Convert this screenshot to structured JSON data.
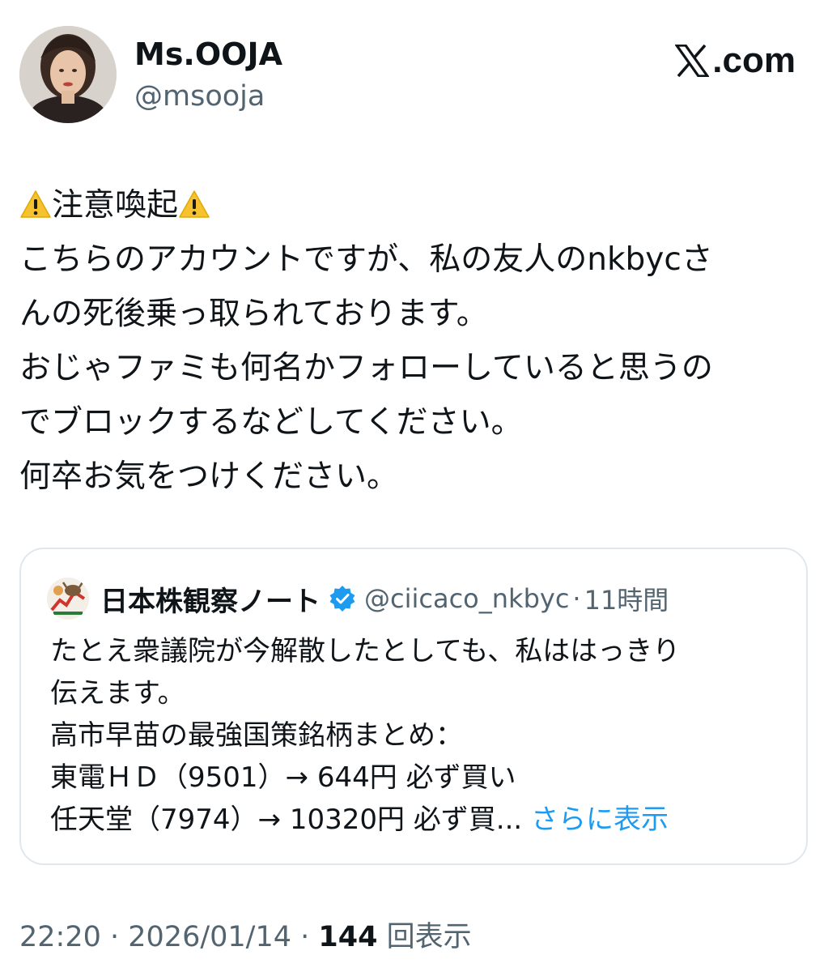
{
  "author": {
    "display_name": "Ms.OOJA",
    "handle": "@msooja"
  },
  "brand": {
    "icon": "x-logo-icon",
    "text": ".com"
  },
  "tweet": {
    "lines": [
      "注意喚起",
      "こちらのアカウントですが、私の友人のnkbycさ",
      "んの死後乗っ取られております。",
      "おじゃファミも何名かフォローしていると思うの",
      "でブロックするなどしてください。",
      "何卒お気をつけください。"
    ]
  },
  "quote": {
    "name": "日本株観察ノート",
    "verified": true,
    "handle": "@ciicaco_nkbyc",
    "separator": "·",
    "time": "11時間",
    "lines": [
      "たとえ衆議院が今解散したとしても、私ははっきり",
      "伝えます。",
      "高市早苗の最強国策銘柄まとめ：",
      "東電ＨＤ（9501）→ 644円 必ず買い",
      "任天堂（7974）→ 10320円 必ず買..."
    ],
    "show_more": "さらに表示"
  },
  "meta": {
    "time": "22:20",
    "dot1": " · ",
    "date": "2026/01/14",
    "dot2": " · ",
    "views_count": "144",
    "views_label": "回表示"
  },
  "colors": {
    "text": "#0f1419",
    "secondary": "#536471",
    "link": "#1d9bf0",
    "verified": "#1d9bf0",
    "border": "#e1e8ed",
    "warning": "#f7c22f"
  }
}
